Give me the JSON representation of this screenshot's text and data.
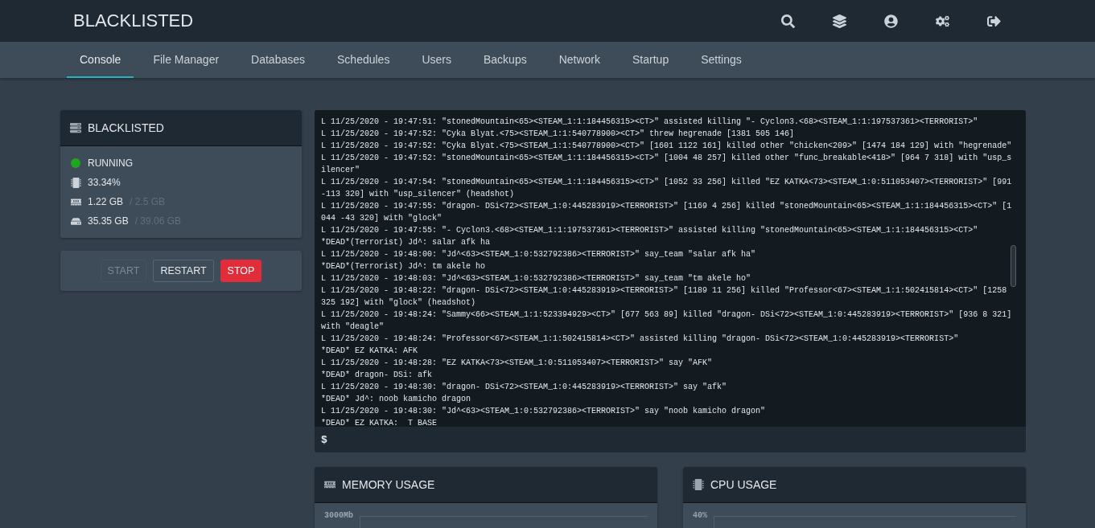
{
  "brand": "BLACKLISTED",
  "nav_icons": [
    {
      "kind": "search"
    },
    {
      "kind": "layers"
    },
    {
      "kind": "account"
    },
    {
      "kind": "settings"
    },
    {
      "kind": "logout"
    }
  ],
  "tabs": [
    {
      "label": "Console",
      "selected": true
    },
    {
      "label": "File Manager",
      "selected": false
    },
    {
      "label": "Databases",
      "selected": false
    },
    {
      "label": "Schedules",
      "selected": false
    },
    {
      "label": "Users",
      "selected": false
    },
    {
      "label": "Backups",
      "selected": false
    },
    {
      "label": "Network",
      "selected": false
    },
    {
      "label": "Startup",
      "selected": false
    },
    {
      "label": "Settings",
      "selected": false
    }
  ],
  "server": {
    "name": "BLACKLISTED",
    "status": {
      "label": "RUNNING",
      "color": "#1fa51f"
    },
    "stats": [
      {
        "kind": "cpu",
        "value": "33.34%"
      },
      {
        "kind": "memory",
        "value": "1.22 GB",
        "limit": "/ 2.5 GB"
      },
      {
        "kind": "disk",
        "value": "35.35 GB",
        "limit": "/ 39.06 GB"
      }
    ]
  },
  "power_buttons": [
    {
      "label": "START",
      "kind": "outline",
      "disabled": true
    },
    {
      "label": "RESTART",
      "kind": "outline",
      "disabled": false
    },
    {
      "label": "STOP",
      "kind": "danger",
      "disabled": false
    }
  ],
  "console": {
    "lines": [
      "L 11/25/2020 - 19:47:51: \"stonedMountain<65><STEAM_1:1:184456315><CT>\" assisted killing \"- Cyclon3.<68><STEAM_1:1:197537361><TERRORIST>\"",
      "L 11/25/2020 - 19:47:52: \"Cyka Blyat.<75><STEAM_1:1:540778900><CT>\" threw hegrenade [1381 505 146]",
      "L 11/25/2020 - 19:47:52: \"Cyka Blyat.<75><STEAM_1:1:540778900><CT>\" [1601 1122 161] killed other \"chicken<209>\" [1474 184 129] with \"hegrenade\"",
      "L 11/25/2020 - 19:47:52: \"stonedMountain<65><STEAM_1:1:184456315><CT>\" [1004 48 257] killed other \"func_breakable<418>\" [964 7 318] with \"usp_silencer\"",
      "L 11/25/2020 - 19:47:54: \"stonedMountain<65><STEAM_1:1:184456315><CT>\" [1052 33 256] killed \"EZ KATKA<73><STEAM_1:0:511053407><TERRORIST>\" [991 -113 320] with \"usp_silencer\" (headshot)",
      "L 11/25/2020 - 19:47:55: \"dragon- DSi<72><STEAM_1:0:445283919><TERRORIST>\" [1169 4 256] killed \"stonedMountain<65><STEAM_1:1:184456315><CT>\" [1044 -43 320] with \"glock\"",
      "L 11/25/2020 - 19:47:55: \"- Cyclon3.<68><STEAM_1:1:197537361><TERRORIST>\" assisted killing \"stonedMountain<65><STEAM_1:1:184456315><CT>\"",
      "*DEAD*(Terrorist) Jd^: salar afk ha",
      "L 11/25/2020 - 19:48:00: \"Jd^<63><STEAM_1:0:532792386><TERRORIST>\" say_team \"salar afk ha\"",
      "*DEAD*(Terrorist) Jd^: tm akele ho",
      "L 11/25/2020 - 19:48:03: \"Jd^<63><STEAM_1:0:532792386><TERRORIST>\" say_team \"tm akele ho\"",
      "L 11/25/2020 - 19:48:22: \"dragon- DSi<72><STEAM_1:0:445283919><TERRORIST>\" [1189 11 256] killed \"Professor<67><STEAM_1:1:502415814><CT>\" [1258 325 192] with \"glock\" (headshot)",
      "L 11/25/2020 - 19:48:24: \"Sammy<66><STEAM_1:1:523394929><CT>\" [677 563 89] killed \"dragon- DSi<72><STEAM_1:0:445283919><TERRORIST>\" [936 8 321] with \"deagle\"",
      "L 11/25/2020 - 19:48:24: \"Professor<67><STEAM_1:1:502415814><CT>\" assisted killing \"dragon- DSi<72><STEAM_1:0:445283919><TERRORIST>\"",
      "*DEAD* EZ KATKA: AFK",
      "L 11/25/2020 - 19:48:28: \"EZ KATKA<73><STEAM_1:0:511053407><TERRORIST>\" say \"AFK\"",
      "*DEAD* dragon- DSi: afk",
      "L 11/25/2020 - 19:48:30: \"dragon- DSi<72><STEAM_1:0:445283919><TERRORIST>\" say \"afk\"",
      "*DEAD* Jd^: noob kamicho dragon",
      "L 11/25/2020 - 19:48:30: \"Jd^<63><STEAM_1:0:532792386><TERRORIST>\" say \"noob kamicho dragon\"",
      "*DEAD* EZ KATKA:  T BASE"
    ],
    "prompt": "$"
  },
  "charts": [
    {
      "kind": "memory",
      "title": "MEMORY USAGE",
      "top_tick": "3000Mb"
    },
    {
      "kind": "cpu",
      "title": "CPU USAGE",
      "top_tick": "40%"
    }
  ]
}
